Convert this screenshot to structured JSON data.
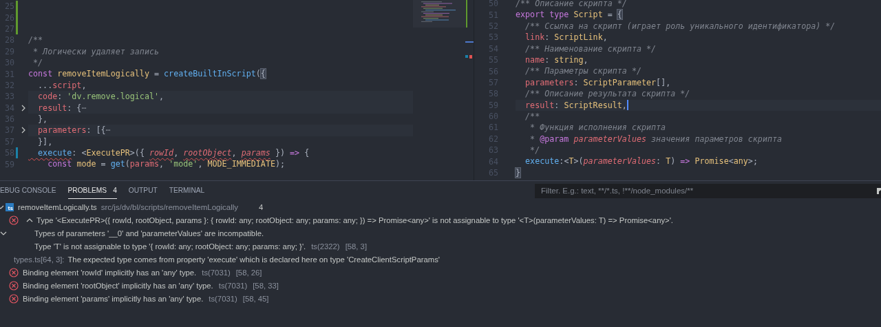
{
  "editors": [
    {
      "lines": [
        {
          "number": "25",
          "added": true
        },
        {
          "number": "26",
          "added": true
        },
        {
          "number": "27",
          "added": true
        },
        {
          "number": "28",
          "tokens": [
            {
              "text": "/**",
              "kind": "com"
            }
          ]
        },
        {
          "number": "29",
          "tokens": [
            {
              "text": " * Логически удаляет запись",
              "kind": "com"
            }
          ]
        },
        {
          "number": "30",
          "tokens": [
            {
              "text": " */",
              "kind": "com"
            }
          ]
        },
        {
          "number": "31",
          "tokens": [
            {
              "text": "const ",
              "kind": "kw"
            },
            {
              "text": "removeItemLogically",
              "kind": "var"
            },
            {
              "text": " = ",
              "kind": "punct"
            },
            {
              "text": "createBuiltInScript",
              "kind": "fn"
            },
            {
              "text": "(",
              "kind": "punct"
            },
            {
              "text": "{",
              "kind": "match"
            }
          ]
        },
        {
          "number": "32",
          "tokens": [
            {
              "text": "  ...",
              "kind": "punct"
            },
            {
              "text": "script",
              "kind": "prop"
            },
            {
              "text": ",",
              "kind": "punct"
            }
          ]
        },
        {
          "number": "33",
          "highlighted": true,
          "tokens": [
            {
              "text": "  code",
              "kind": "prop"
            },
            {
              "text": ": ",
              "kind": "punct"
            },
            {
              "text": "'dv.remove.logical'",
              "kind": "str"
            },
            {
              "text": ",",
              "kind": "punct"
            }
          ]
        },
        {
          "number": "34",
          "folded": true,
          "highlighted": true,
          "tokens": [
            {
              "text": "  result",
              "kind": "prop"
            },
            {
              "text": ": {",
              "kind": "punct"
            },
            {
              "text": "⋯",
              "kind": "dim"
            }
          ]
        },
        {
          "number": "36",
          "tokens": [
            {
              "text": "  },",
              "kind": "punct"
            }
          ]
        },
        {
          "number": "37",
          "folded": true,
          "highlighted": true,
          "tokens": [
            {
              "text": "  parameters",
              "kind": "prop"
            },
            {
              "text": ": [{",
              "kind": "punct"
            },
            {
              "text": "⋯",
              "kind": "dim"
            }
          ]
        },
        {
          "number": "57",
          "tokens": [
            {
              "text": "  }],",
              "kind": "punct"
            }
          ]
        },
        {
          "number": "58",
          "modified": true,
          "tokens": [
            {
              "text": "  execute",
              "kind": "fn",
              "squiggle": true
            },
            {
              "text": ": <",
              "kind": "punct"
            },
            {
              "text": "ExecutePR",
              "kind": "type"
            },
            {
              "text": ">({ ",
              "kind": "punct"
            },
            {
              "text": "rowId",
              "kind": "param",
              "squiggle": true
            },
            {
              "text": ", ",
              "kind": "punct"
            },
            {
              "text": "rootObject",
              "kind": "param",
              "squiggle": true
            },
            {
              "text": ", ",
              "kind": "punct"
            },
            {
              "text": "params",
              "kind": "param",
              "squiggle": true
            },
            {
              "text": " }) ",
              "kind": "punct"
            },
            {
              "text": "=>",
              "kind": "kw"
            },
            {
              "text": " {",
              "kind": "punct"
            }
          ]
        },
        {
          "number": "59",
          "tokens": [
            {
              "text": "    const ",
              "kind": "kw"
            },
            {
              "text": "mode",
              "kind": "var"
            },
            {
              "text": " = ",
              "kind": "punct"
            },
            {
              "text": "get",
              "kind": "fn"
            },
            {
              "text": "(",
              "kind": "punct"
            },
            {
              "text": "params",
              "kind": "prop"
            },
            {
              "text": ", ",
              "kind": "punct"
            },
            {
              "text": "'mode'",
              "kind": "str"
            },
            {
              "text": ", ",
              "kind": "punct"
            },
            {
              "text": "MODE_IMMEDIATE",
              "kind": "var"
            },
            {
              "text": ");",
              "kind": "punct"
            }
          ]
        }
      ]
    },
    {
      "lines": [
        {
          "number": "50",
          "tokens": [
            {
              "text": "/** Описание скрипта */",
              "kind": "com"
            }
          ]
        },
        {
          "number": "51",
          "tokens": [
            {
              "text": "export type ",
              "kind": "kw"
            },
            {
              "text": "Script",
              "kind": "type"
            },
            {
              "text": " = ",
              "kind": "punct"
            },
            {
              "text": "{",
              "kind": "match"
            }
          ]
        },
        {
          "number": "52",
          "tokens": [
            {
              "text": "  /** Ссылка на скрипт (играет роль уникального идентификатора) */",
              "kind": "com"
            }
          ]
        },
        {
          "number": "53",
          "tokens": [
            {
              "text": "  link",
              "kind": "prop"
            },
            {
              "text": ": ",
              "kind": "punct"
            },
            {
              "text": "ScriptLink",
              "kind": "type"
            },
            {
              "text": ",",
              "kind": "punct"
            }
          ]
        },
        {
          "number": "54",
          "tokens": [
            {
              "text": "  /** Наименование скрипта */",
              "kind": "com"
            }
          ]
        },
        {
          "number": "55",
          "tokens": [
            {
              "text": "  name",
              "kind": "prop"
            },
            {
              "text": ": ",
              "kind": "punct"
            },
            {
              "text": "string",
              "kind": "type"
            },
            {
              "text": ",",
              "kind": "punct"
            }
          ]
        },
        {
          "number": "56",
          "tokens": [
            {
              "text": "  /** Параметры скрипта */",
              "kind": "com"
            }
          ]
        },
        {
          "number": "57",
          "tokens": [
            {
              "text": "  parameters",
              "kind": "prop"
            },
            {
              "text": ": ",
              "kind": "punct"
            },
            {
              "text": "ScriptParameter",
              "kind": "type"
            },
            {
              "text": "[],",
              "kind": "punct"
            }
          ]
        },
        {
          "number": "58",
          "tokens": [
            {
              "text": "  /** Описание результата скрипта */",
              "kind": "com"
            }
          ]
        },
        {
          "number": "59",
          "highlighted": true,
          "cursor": true,
          "tokens": [
            {
              "text": "  result",
              "kind": "prop"
            },
            {
              "text": ": ",
              "kind": "punct"
            },
            {
              "text": "ScriptResult",
              "kind": "type"
            },
            {
              "text": ",",
              "kind": "punct"
            }
          ]
        },
        {
          "number": "60",
          "tokens": [
            {
              "text": "  /**",
              "kind": "com"
            }
          ]
        },
        {
          "number": "61",
          "tokens": [
            {
              "text": "   * Функция исполнения скрипта",
              "kind": "com"
            }
          ]
        },
        {
          "number": "62",
          "tokens": [
            {
              "text": "   * ",
              "kind": "com"
            },
            {
              "text": "@param",
              "kind": "kw"
            },
            {
              "text": " parameterValues",
              "kind": "param"
            },
            {
              "text": " значения параметров скрипта",
              "kind": "com"
            }
          ]
        },
        {
          "number": "63",
          "tokens": [
            {
              "text": "   */",
              "kind": "com"
            }
          ]
        },
        {
          "number": "64",
          "tokens": [
            {
              "text": "  execute",
              "kind": "fn"
            },
            {
              "text": ":<",
              "kind": "punct"
            },
            {
              "text": "T",
              "kind": "type"
            },
            {
              "text": ">(",
              "kind": "punct"
            },
            {
              "text": "parameterValues",
              "kind": "param"
            },
            {
              "text": ": ",
              "kind": "punct"
            },
            {
              "text": "T",
              "kind": "type"
            },
            {
              "text": ") ",
              "kind": "punct"
            },
            {
              "text": "=>",
              "kind": "kw"
            },
            {
              "text": " Promise",
              "kind": "type"
            },
            {
              "text": "<",
              "kind": "punct"
            },
            {
              "text": "any",
              "kind": "type"
            },
            {
              "text": ">;",
              "kind": "punct"
            }
          ]
        },
        {
          "number": "65",
          "tokens": [
            {
              "text": "}",
              "kind": "match"
            }
          ]
        }
      ]
    }
  ],
  "panel": {
    "tabs": [
      {
        "label": "EBUG CONSOLE",
        "selected": false
      },
      {
        "label": "PROBLEMS",
        "selected": true,
        "badge": "4"
      },
      {
        "label": "OUTPUT",
        "selected": false
      },
      {
        "label": "TERMINAL",
        "selected": false
      }
    ],
    "filter": {
      "placeholder": "Filter. E.g.: text, **/*.ts, !**/node_modules/**"
    },
    "files": [
      {
        "expanded": true,
        "icon_label": "ts",
        "name": "removeItemLogically.ts",
        "path": "src/js/dv/bl/scripts/removeItemLogically",
        "count": "4",
        "problems": [
          {
            "kind": "error",
            "expanded": true,
            "message": [
              "Type '<ExecutePR>({ rowId, rootObject, params }: { rowId: any; rootObject: any; params: any; }) => Promise<any>' is not assignable to type '<T>(parameterValues: T) => Promise<any>'.",
              "Types of parameters '__0' and 'parameterValues' are incompatible.",
              "Type 'T' is not assignable to type '{ rowId: any; rootObject: any; params: any; }'."
            ],
            "source": "ts(2322)",
            "position": "[58, 3]",
            "related_expanded": true,
            "related": [
              {
                "location": "types.ts[64, 3]:",
                "text": "The expected type comes from property 'execute' which is declared here on type 'CreateClientScriptParams'"
              }
            ]
          },
          {
            "kind": "error",
            "message": [
              "Binding element 'rowId' implicitly has an 'any' type."
            ],
            "source": "ts(7031)",
            "position": "[58, 26]"
          },
          {
            "kind": "error",
            "message": [
              "Binding element 'rootObject' implicitly has an 'any' type."
            ],
            "source": "ts(7031)",
            "position": "[58, 33]"
          },
          {
            "kind": "error",
            "message": [
              "Binding element 'params' implicitly has an 'any' type."
            ],
            "source": "ts(7031)",
            "position": "[58, 45]"
          }
        ]
      }
    ]
  }
}
